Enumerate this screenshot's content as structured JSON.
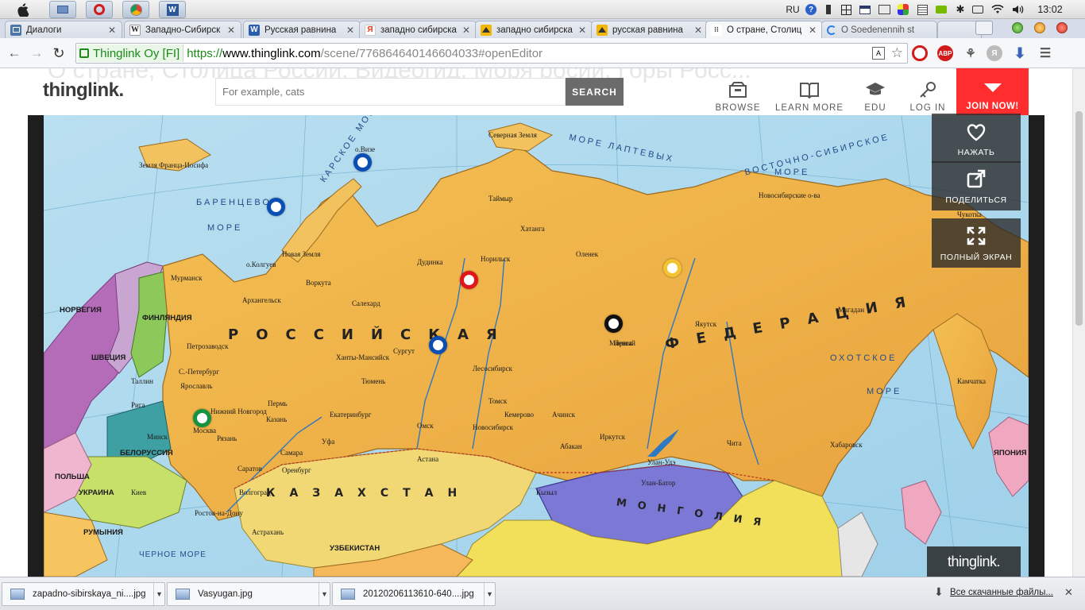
{
  "menubar": {
    "lang": "RU",
    "clock": "13:02"
  },
  "tabs": [
    {
      "label": "Диалоги",
      "fav": "",
      "fav_color": "#4a76a8"
    },
    {
      "label": "Западно-Сибирск",
      "fav": "W",
      "fav_color": "#ffffff"
    },
    {
      "label": "Русская равнина",
      "fav": "W",
      "fav_color": "#2a5db0"
    },
    {
      "label": "западно сибирска",
      "fav": "Я",
      "fav_color": "#ffffff"
    },
    {
      "label": "западно сибирска",
      "fav": "",
      "fav_color": "#f2b705"
    },
    {
      "label": "русская равнина",
      "fav": "",
      "fav_color": "#f2b705"
    },
    {
      "label": "О стране, Столиц",
      "fav": "",
      "fav_color": "#ffffff"
    },
    {
      "label": "O Soedenennih st",
      "fav": "",
      "fav_color": "#ffffff"
    }
  ],
  "address": {
    "ev_label": "Thinglink Oy [FI]",
    "https": "https://",
    "host": "www.thinglink.com",
    "path": "/scene/776864640146604033#openEditor"
  },
  "page": {
    "ghost_title": "О стране, Столица России, Видеогид, Моря росии, Горы Росс...",
    "logo": "thinglink.",
    "search_placeholder": "For example, cats",
    "search_button": "SEARCH",
    "nav": {
      "browse": "BROWSE",
      "learn_more": "LEARN MORE",
      "edu": "EDU",
      "log_in": "LOG IN",
      "join_now": "JOIN NOW!"
    },
    "side": {
      "like": "НАЖАТЬ",
      "share": "ПОДЕЛИТЬСЯ",
      "fullscreen": "ПОЛНЫЙ ЭКРАН"
    },
    "badge": "thinglink."
  },
  "map": {
    "country_label": "РОССИЙСКАЯ",
    "federation_label": "ФЕДЕРАЦИЯ",
    "kazakhstan": "КАЗАХСТАН",
    "mongolia": "МОНГОЛИЯ",
    "seas": {
      "barents": "БАРЕНЦЕВО",
      "barents_more": "МОРЕ",
      "kara": "КАРСКОЕ МОРЕ",
      "laptev": "МОРЕ ЛАПТЕВЫХ",
      "east_siberian": "ВОСТОЧНО-СИБИРСКОЕ",
      "east_siberian_more": "МОРЕ",
      "okhotsk": "ОХОТСКОЕ",
      "okhotsk_more": "МОРЕ",
      "black_sea": "ЧЕРНОЕ МОРЕ"
    },
    "places": [
      "Северная Земля",
      "Земля Франца-Иосифа",
      "о.Визе",
      "Таймыр",
      "Новосибирские о-ва",
      "Новая Земля",
      "о.Колгуев",
      "Воркута",
      "Салехард",
      "Норильск",
      "Дудинка",
      "Хатанга",
      "Оленек",
      "Мирный",
      "Якутск",
      "Ленск",
      "Сургут",
      "Ханты-Мансийск",
      "Тюмень",
      "Омск",
      "Новосибирск",
      "Кемерово",
      "Томск",
      "Иркутск",
      "Улан-Удэ",
      "Чита",
      "Екатеринбург",
      "Пермь",
      "Казань",
      "Самара",
      "Саратов",
      "Волгоград",
      "Ростов-на-Дону",
      "Ярославль",
      "Москва",
      "С.-Петербург",
      "Мурманск",
      "Архангельск",
      "Петрозаводск",
      "Нижний Новгород",
      "Рязань",
      "Уфа",
      "Оренбург",
      "Астрахань",
      "Астана",
      "Улан-Батор",
      "Магадан",
      "Хабаровск",
      "Лесосибирск",
      "Ачинск",
      "Абакан",
      "Кызыл",
      "Чукотка",
      "Камчатка",
      "ЯПОНИЯ",
      "БЕЛОРУССИЯ",
      "УКРАИНА",
      "ПОЛЬША",
      "РУМЫНИЯ",
      "УЗБЕКИСТАН",
      "ФИНЛЯНДИЯ",
      "ШВЕЦИЯ",
      "НОРВЕГИЯ",
      "Таллин",
      "Рига",
      "Минск",
      "Киев"
    ],
    "marker_colors": {
      "blue": "#0b4fb5",
      "red": "#e0161b",
      "black": "#111111",
      "yellow": "#f4c430",
      "green": "#159340"
    }
  },
  "downloads": [
    {
      "name": "zapadno-sibirskaya_ni....jpg"
    },
    {
      "name": "Vasyugan.jpg"
    },
    {
      "name": "20120206113610-640....jpg"
    }
  ],
  "all_downloads": "Все скачанные файлы..."
}
